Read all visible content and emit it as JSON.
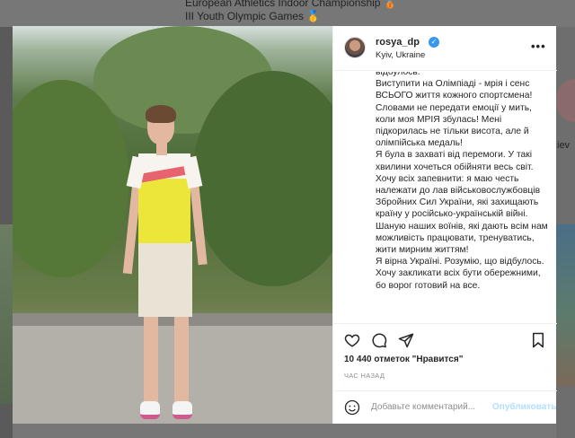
{
  "background": {
    "line1": "European Athletics Indoor Championship 🥉",
    "line2": "III Youth Olympic Games 🥇",
    "side_name": "iev"
  },
  "post": {
    "username": "rosya_dp",
    "location": "Kyiv, Ukraine",
    "more_icon": "more-horizontal-icon",
    "caption": "відбулось.\nВиступити на Олімпіаді - мрія і сенс ВСЬОГО життя кожного спортсмена! Словами не передати емоції у мить, коли моя МРІЯ збулась! Мені підкорилась не тільки висота, але й олімпійська медаль!\nЯ була в захваті від перемоги. У такі хвилини хочеться обійняти весь світ.\nХочу всіх запевнити: я маю честь належати до лав військовослужбовців Збройних Сил України, які захищають країну у російсько-українській війні. Шаную наших воїнів, які дають всім нам можливість працювати, тренуватись, жити мирним життям!\nЯ вірна Україні. Розумію, що відбулось. Хочу закликати всіх бути обережними, бо ворог готовий на все.",
    "likes": "10 440 отметок \"Нравится\"",
    "time": "ЧАС НАЗАД",
    "comment_placeholder": "Добавьте комментарий...",
    "post_label": "Опубликовать",
    "accent": "#3897f0"
  }
}
